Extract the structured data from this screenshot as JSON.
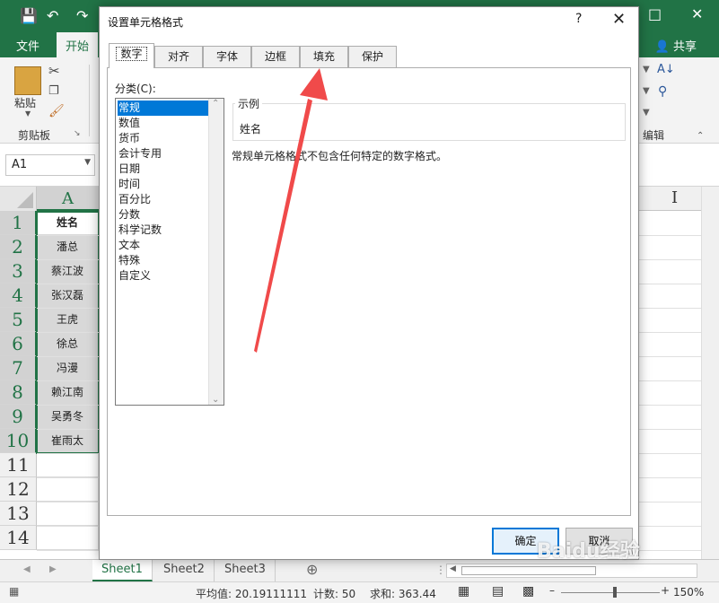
{
  "excel": {
    "ribbon_tabs": [
      "文件",
      "开始"
    ],
    "share_label": "共享",
    "clipboard_group": "剪贴板",
    "paste_label": "粘贴",
    "edit_group": "编辑",
    "name_box": "A1",
    "column_header": "A",
    "row_numbers": [
      "1",
      "2",
      "3",
      "4",
      "5",
      "6",
      "7",
      "8",
      "9",
      "10",
      "11",
      "12",
      "13",
      "14"
    ],
    "cells": [
      "姓名",
      "潘总",
      "蔡江波",
      "张汉磊",
      "王虎",
      "徐总",
      "冯漫",
      "赖江南",
      "吴勇冬",
      "崔雨太"
    ],
    "sheet_tabs": [
      "Sheet1",
      "Sheet2",
      "Sheet3"
    ],
    "status": {
      "average": "平均值: 20.19111111",
      "count": "计数: 50",
      "sum": "求和: 363.44",
      "zoom": "150%"
    }
  },
  "dialog": {
    "title": "设置单元格格式",
    "help": "?",
    "tabs": [
      "数字",
      "对齐",
      "字体",
      "边框",
      "填充",
      "保护"
    ],
    "category_label": "分类(C):",
    "categories": [
      "常规",
      "数值",
      "货币",
      "会计专用",
      "日期",
      "时间",
      "百分比",
      "分数",
      "科学记数",
      "文本",
      "特殊",
      "自定义"
    ],
    "sample_legend": "示例",
    "sample_value": "姓名",
    "description": "常规单元格格式不包含任何特定的数字格式。",
    "ok_label": "确定",
    "cancel_label": "取消"
  },
  "colors": {
    "excel_green": "#217346",
    "selection_blue": "#0078d7",
    "annotation_red": "#f04a4a"
  },
  "watermark": "Baidu经验"
}
